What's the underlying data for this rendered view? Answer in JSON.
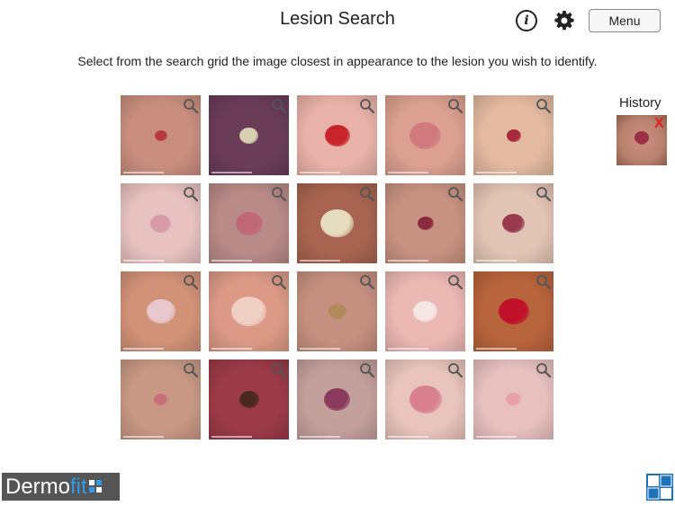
{
  "header": {
    "title": "Lesion Search",
    "menu_label": "Menu",
    "info_label": "i"
  },
  "instruction": "Select from the search grid the image closest in appearance to the lesion you wish to identify.",
  "history": {
    "label": "History",
    "close_label": "X"
  },
  "brand": {
    "part1": "Dermo",
    "part2": "fit"
  },
  "colors": {
    "history_close": "#e02020",
    "brand_accent": "#2f9be8",
    "brand_bg": "#555555"
  },
  "grid": {
    "tiles": [
      {
        "bg": "#c98e7e",
        "lesion": "#b83a3e"
      },
      {
        "bg": "#6a3c58",
        "lesion": "#d9d0b0"
      },
      {
        "bg": "#e9b2a8",
        "lesion": "#c8242c"
      },
      {
        "bg": "#dba090",
        "lesion": "#d07a7e"
      },
      {
        "bg": "#e3b9a0",
        "lesion": "#a82a3e"
      },
      {
        "bg": "#e8c2c0",
        "lesion": "#d89aa8"
      },
      {
        "bg": "#b88a88",
        "lesion": "#c06878"
      },
      {
        "bg": "#a86450",
        "lesion": "#e6dcc0"
      },
      {
        "bg": "#c89282",
        "lesion": "#8a2a3e"
      },
      {
        "bg": "#e2c4b4",
        "lesion": "#9a3a4e"
      },
      {
        "bg": "#d29278",
        "lesion": "#e8c8cc"
      },
      {
        "bg": "#dc9a86",
        "lesion": "#f0d0c4"
      },
      {
        "bg": "#c69080",
        "lesion": "#b08a5a"
      },
      {
        "bg": "#ecb8b4",
        "lesion": "#f6e6e4"
      },
      {
        "bg": "#b8643c",
        "lesion": "#c0102a"
      },
      {
        "bg": "#c89884",
        "lesion": "#c86e78"
      },
      {
        "bg": "#9c3a48",
        "lesion": "#4a2a20"
      },
      {
        "bg": "#c4a09c",
        "lesion": "#8a3a5a"
      },
      {
        "bg": "#e8c4bc",
        "lesion": "#d88090"
      },
      {
        "bg": "#e8c0c0",
        "lesion": "#e8a0a8"
      }
    ]
  }
}
